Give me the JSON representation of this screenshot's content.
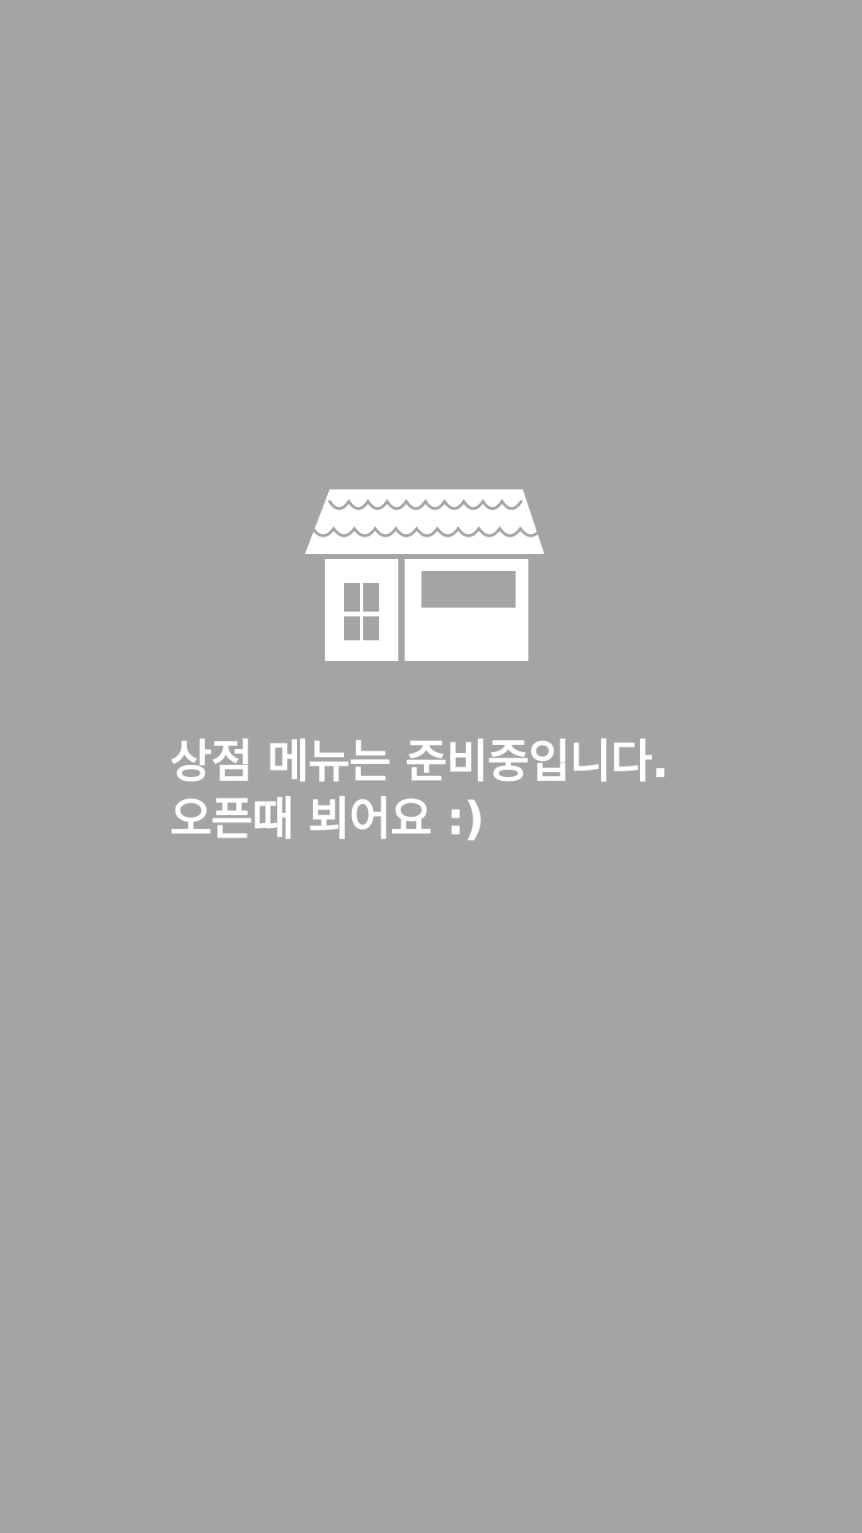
{
  "screen": {
    "background_color": "#a3a4a3",
    "illustration_icon": "shop-storefront-icon"
  },
  "message": {
    "line1": "상점 메뉴는 준비중입니다.",
    "line2": "오픈때 뵈어요 :)"
  }
}
